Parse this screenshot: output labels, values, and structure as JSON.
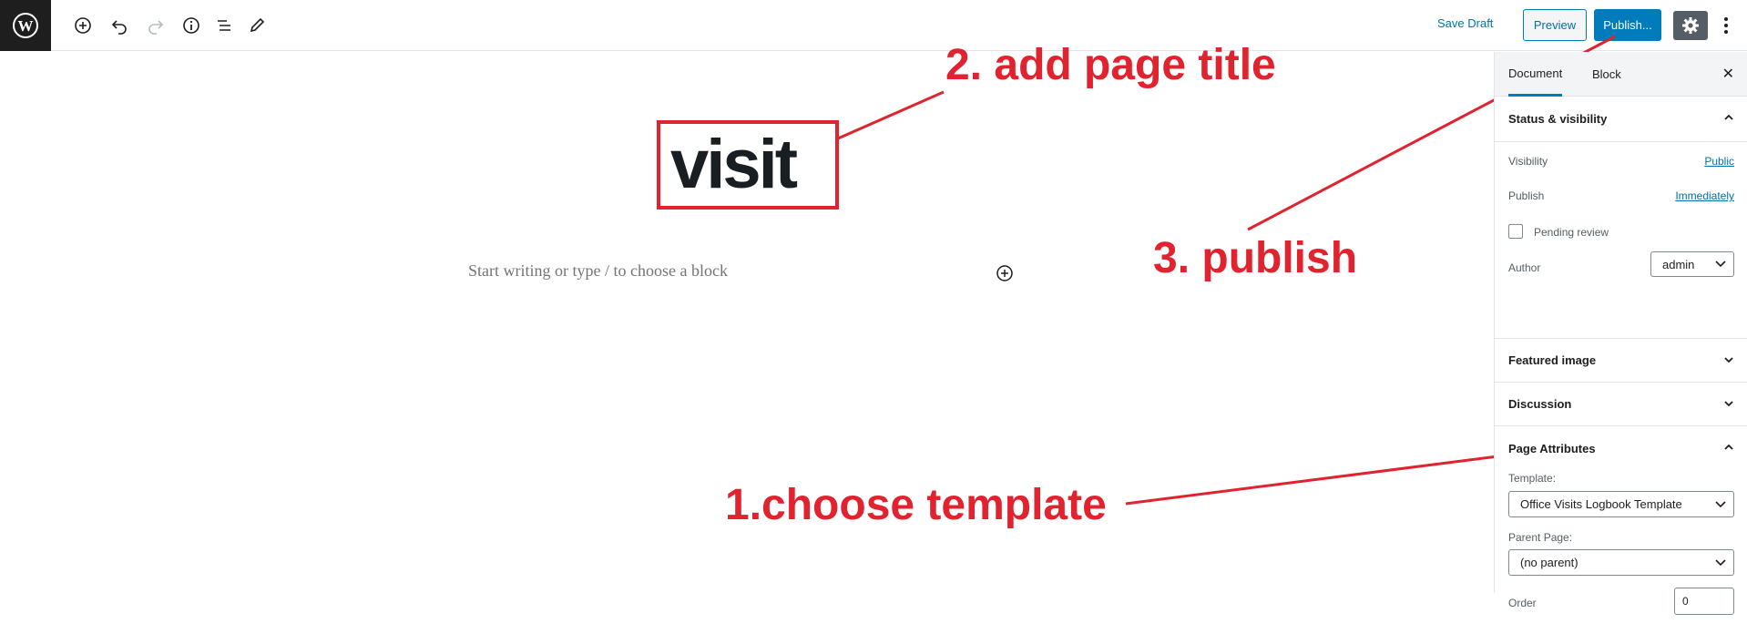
{
  "toolbar": {
    "logo": "wordpress-icon",
    "tools": [
      "add-block-icon",
      "undo-icon",
      "redo-icon",
      "info-icon",
      "list-view-icon",
      "edit-icon"
    ],
    "save_draft": "Save Draft",
    "preview": "Preview",
    "publish": "Publish...",
    "settings": "gear-icon",
    "more": "more-vertical-icon"
  },
  "editor": {
    "title": "visit",
    "placeholder": "Start writing or type / to choose a block"
  },
  "annotations": {
    "step1": "1.choose template",
    "step2": "2. add page title",
    "step3": "3. publish",
    "color": "#e0232f"
  },
  "sidebar": {
    "tabs": [
      "Document",
      "Block"
    ],
    "status": {
      "title": "Status & visibility",
      "visibility_label": "Visibility",
      "visibility_value": "Public",
      "publish_label": "Publish",
      "publish_value": "Immediately",
      "pending_label": "Pending review",
      "author_label": "Author",
      "author_value": "admin"
    },
    "featured_image": "Featured image",
    "discussion": "Discussion",
    "page_attributes": {
      "title": "Page Attributes",
      "template_label": "Template:",
      "template_value": "Office Visits Logbook Template",
      "parent_label": "Parent Page:",
      "parent_value": "(no parent)",
      "order_label": "Order",
      "order_value": "0"
    }
  },
  "colors": {
    "accent": "#007cba",
    "dark": "#1e1e1e",
    "settings_bg": "#555d66"
  }
}
